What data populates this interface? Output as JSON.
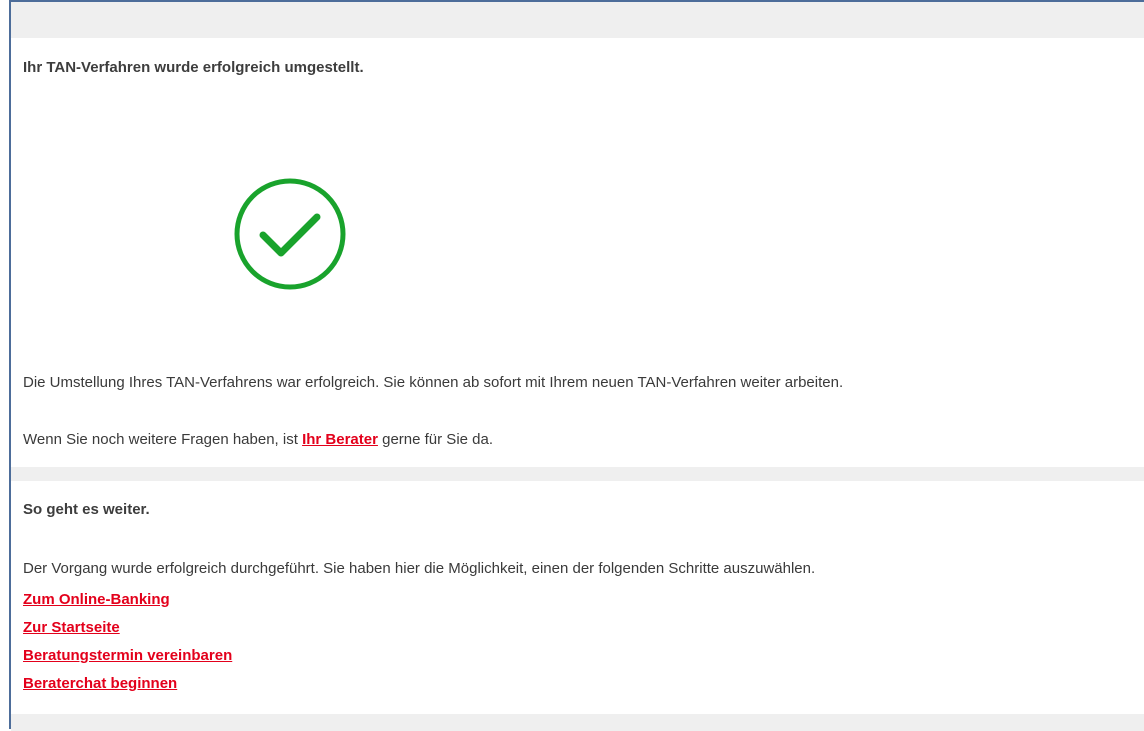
{
  "confirmation": {
    "heading": "Ihr TAN-Verfahren wurde erfolgreich umgestellt.",
    "success_icon": "check-circle-icon",
    "success_color": "#19a32c",
    "message": "Die Umstellung Ihres TAN-Verfahrens war erfolgreich. Sie können ab sofort mit Ihrem neuen TAN-Verfahren weiter arbeiten.",
    "question_prefix": "Wenn Sie noch weitere Fragen haben, ist ",
    "advisor_link": "Ihr Berater",
    "question_suffix": " gerne für Sie da."
  },
  "next_steps": {
    "heading": "So geht es weiter.",
    "description": "Der Vorgang wurde erfolgreich durchgeführt. Sie haben hier die Möglichkeit,  einen der folgenden Schritte auszuwählen.",
    "links": [
      "Zum Online-Banking",
      "Zur Startseite",
      "Beratungstermin vereinbaren",
      "Beraterchat beginnen"
    ]
  },
  "colors": {
    "link": "#e3001b",
    "frame_border": "#4d6d9a",
    "bar_background": "#efefef"
  }
}
